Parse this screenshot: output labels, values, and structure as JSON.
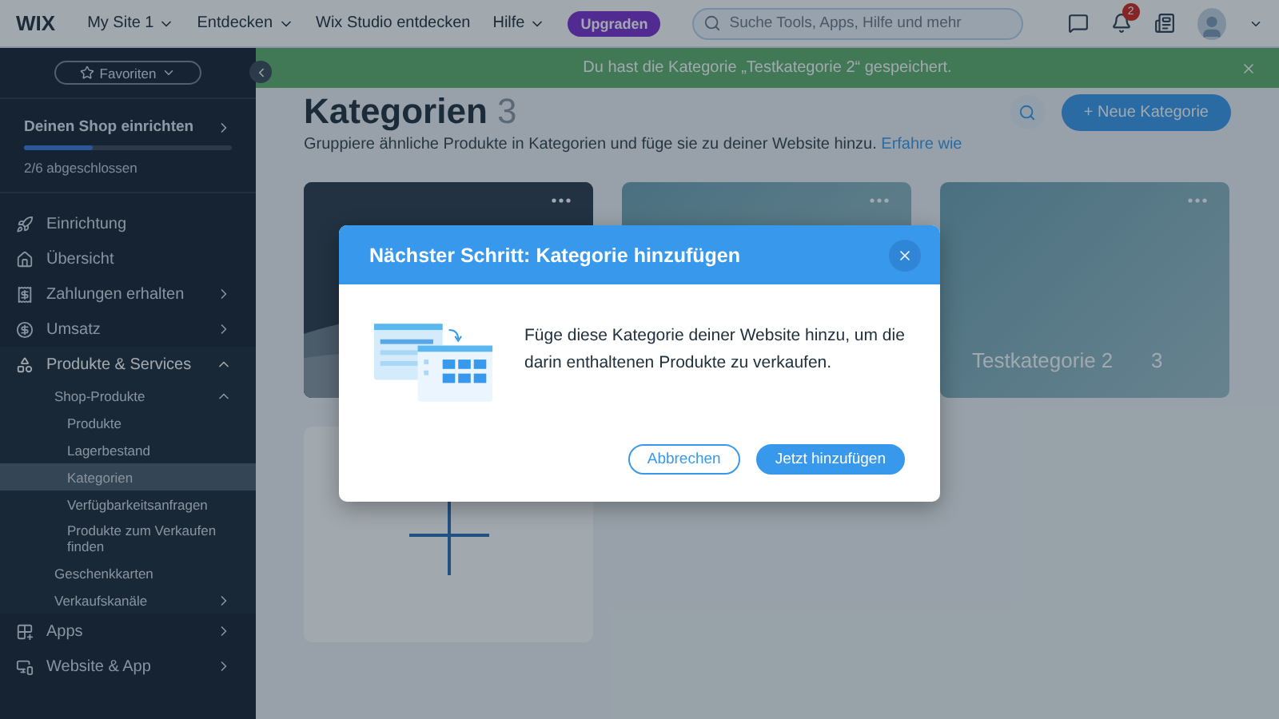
{
  "topbar": {
    "logo": "WIX",
    "site": "My Site 1",
    "menus": [
      {
        "label": "Entdecken",
        "dropdown": true
      },
      {
        "label": "Wix Studio entdecken",
        "dropdown": false
      },
      {
        "label": "Hilfe",
        "dropdown": true
      }
    ],
    "upgrade": "Upgraden",
    "search": {
      "placeholder": "Suche Tools, Apps, Hilfe und mehr"
    },
    "notifications": "2"
  },
  "sidebar": {
    "favorites": "Favoriten",
    "setup": {
      "title": "Deinen Shop einrichten",
      "level": 0.33,
      "progress": "2/6 abgeschlossen"
    },
    "items": [
      {
        "label": "Einrichtung",
        "selected": false
      },
      {
        "label": "Übersicht",
        "selected": false
      },
      {
        "label": "Zahlungen erhalten",
        "selected": false,
        "expanded": false
      },
      {
        "label": "Umsatz",
        "selected": false,
        "expanded": false
      },
      {
        "label": "Produkte & Services",
        "selected": false,
        "expanded": true,
        "children": [
          {
            "label": "Shop-Produkte",
            "selected": false,
            "expanded": true,
            "children": [
              {
                "label": "Produkte",
                "selected": false
              },
              {
                "label": "Lagerbestand",
                "selected": false
              },
              {
                "label": "Kategorien",
                "selected": true
              },
              {
                "label": "Verfügbarkeitsanfragen",
                "selected": false
              },
              {
                "label": "Produkte zum Verkaufen finden",
                "selected": false
              }
            ]
          },
          {
            "label": "Geschenkkarten",
            "selected": false
          },
          {
            "label": "Verkaufskanäle",
            "selected": false,
            "expanded": false
          }
        ]
      },
      {
        "label": "Apps",
        "selected": false,
        "expanded": false
      },
      {
        "label": "Website & App",
        "selected": false,
        "expanded": false
      }
    ]
  },
  "banner": "Du hast die Kategorie „Testkategorie 2“ gespeichert.",
  "page": {
    "title": "Kategorien",
    "count": "3",
    "subtitle": "Gruppiere ähnliche Produkte in Kategorien und füge sie zu deiner Website hinzu.",
    "link": "Erfahre wie",
    "new_button": "+ Neue Kategorie",
    "cards": [
      {
        "kind": "dark"
      },
      {
        "kind": "teal"
      },
      {
        "kind": "teal",
        "name": "Testkategorie 2",
        "count": "3"
      },
      {
        "kind": "add"
      }
    ]
  },
  "dialog": {
    "title": "Nächster Schritt: Kategorie hinzufügen",
    "text": "Füge diese Kategorie deiner Website hinzu, um die darin enthaltenen Produkte zu verkaufen.",
    "buttons": [
      {
        "label": "Abbrechen",
        "kind": "secondary"
      },
      {
        "label": "Jetzt hinzufügen",
        "kind": "primary"
      }
    ]
  }
}
